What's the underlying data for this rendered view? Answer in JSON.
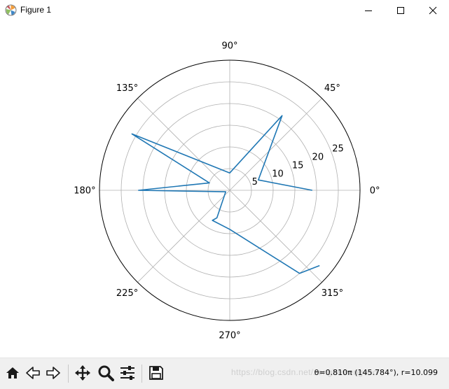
{
  "window": {
    "title": "Figure 1"
  },
  "colors": {
    "series": "#1f77b4",
    "grid": "#b0b0b0",
    "frame": "#000000"
  },
  "chart_data": {
    "type": "line",
    "projection": "polar",
    "theta_tick_labels": [
      "0°",
      "45°",
      "90°",
      "135°",
      "180°",
      "225°",
      "270°",
      "315°"
    ],
    "r_tick_labels": [
      "5",
      "10",
      "15",
      "20",
      "25"
    ],
    "r_ticks": [
      5,
      10,
      15,
      20,
      25
    ],
    "rlim": [
      0,
      30
    ],
    "grid": true,
    "series": [
      {
        "theta_deg": [
          0,
          20,
          55,
          90,
          150,
          160,
          180,
          200,
          245,
          240,
          270,
          310,
          320
        ],
        "r": [
          19,
          7,
          21,
          4,
          26,
          5,
          21,
          1,
          7,
          8,
          9,
          25,
          27
        ]
      }
    ]
  },
  "toolbar": {
    "buttons": [
      "home-icon",
      "back-icon",
      "forward-icon",
      "pan-icon",
      "zoom-icon",
      "configure-subplots-icon",
      "save-icon"
    ],
    "coordinates": "θ=0.810π (145.784°), r=10.099",
    "watermark": "https://blog.csdn.net/zengbowengood"
  }
}
